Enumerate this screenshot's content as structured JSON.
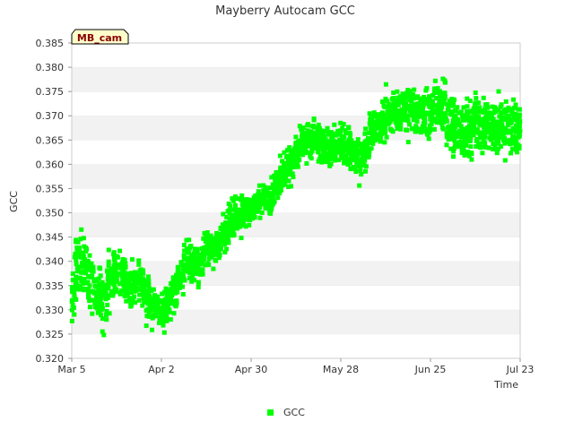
{
  "chart_data": {
    "type": "scatter",
    "title": "Mayberry Autocam GCC",
    "xlabel": "Time",
    "ylabel": "GCC",
    "badge": "MB_cam",
    "x_ticks": [
      "Mar 5",
      "Apr 2",
      "Apr 30",
      "May 28",
      "Jun 25",
      "Jul 23"
    ],
    "y_ticks": [
      "0.320",
      "0.325",
      "0.330",
      "0.335",
      "0.340",
      "0.345",
      "0.350",
      "0.355",
      "0.360",
      "0.365",
      "0.370",
      "0.375",
      "0.380",
      "0.385"
    ],
    "xlim": [
      "Mar 5",
      "Jul 23"
    ],
    "ylim": [
      0.32,
      0.385
    ],
    "grid": "horizontal alternating bands",
    "legend_position": "bottom-center",
    "colors": {
      "series": "#00ff00",
      "badge_fill": "#ffffcc",
      "badge_text": "#8b0000",
      "band": "#f2f2f2"
    },
    "series": [
      {
        "name": "GCC",
        "x": [
          "Mar 5",
          "Mar 7",
          "Mar 9",
          "Mar 11",
          "Mar 13",
          "Mar 15",
          "Mar 17",
          "Mar 19",
          "Mar 21",
          "Mar 23",
          "Mar 25",
          "Mar 27",
          "Mar 29",
          "Mar 31",
          "Apr 2",
          "Apr 4",
          "Apr 6",
          "Apr 8",
          "Apr 10",
          "Apr 12",
          "Apr 14",
          "Apr 16",
          "Apr 18",
          "Apr 20",
          "Apr 22",
          "Apr 24",
          "Apr 26",
          "Apr 28",
          "Apr 30",
          "May 2",
          "May 4",
          "May 6",
          "May 8",
          "May 10",
          "May 12",
          "May 14",
          "May 16",
          "May 18",
          "May 20",
          "May 22",
          "May 24",
          "May 26",
          "May 28",
          "May 30",
          "Jun 1",
          "Jun 3",
          "Jun 5",
          "Jun 7",
          "Jun 9",
          "Jun 11",
          "Jun 13",
          "Jun 15",
          "Jun 17",
          "Jun 19",
          "Jun 21",
          "Jun 23",
          "Jun 25",
          "Jun 27",
          "Jun 29",
          "Jul 1",
          "Jul 3",
          "Jul 5",
          "Jul 7",
          "Jul 9",
          "Jul 11",
          "Jul 13",
          "Jul 15",
          "Jul 17",
          "Jul 19",
          "Jul 21",
          "Jul 23"
        ],
        "y": [
          0.334,
          0.339,
          0.34,
          0.336,
          0.333,
          0.332,
          0.336,
          0.338,
          0.337,
          0.335,
          0.336,
          0.335,
          0.332,
          0.331,
          0.33,
          0.331,
          0.334,
          0.337,
          0.34,
          0.339,
          0.34,
          0.342,
          0.343,
          0.344,
          0.346,
          0.348,
          0.349,
          0.35,
          0.351,
          0.352,
          0.353,
          0.353,
          0.356,
          0.358,
          0.36,
          0.362,
          0.364,
          0.365,
          0.365,
          0.364,
          0.363,
          0.364,
          0.364,
          0.364,
          0.362,
          0.361,
          0.363,
          0.367,
          0.369,
          0.37,
          0.371,
          0.371,
          0.372,
          0.372,
          0.371,
          0.37,
          0.371,
          0.372,
          0.371,
          0.369,
          0.367,
          0.367,
          0.368,
          0.369,
          0.368,
          0.368,
          0.367,
          0.368,
          0.368,
          0.368,
          0.368
        ],
        "spread": [
          0.009,
          0.008,
          0.007,
          0.007,
          0.007,
          0.007,
          0.006,
          0.006,
          0.006,
          0.006,
          0.006,
          0.006,
          0.006,
          0.005,
          0.005,
          0.005,
          0.005,
          0.005,
          0.005,
          0.005,
          0.005,
          0.005,
          0.005,
          0.005,
          0.005,
          0.005,
          0.005,
          0.004,
          0.004,
          0.004,
          0.004,
          0.004,
          0.004,
          0.005,
          0.005,
          0.005,
          0.005,
          0.005,
          0.005,
          0.005,
          0.005,
          0.005,
          0.005,
          0.006,
          0.006,
          0.006,
          0.006,
          0.006,
          0.006,
          0.006,
          0.006,
          0.006,
          0.006,
          0.006,
          0.006,
          0.007,
          0.007,
          0.007,
          0.007,
          0.007,
          0.007,
          0.007,
          0.007,
          0.007,
          0.007,
          0.007,
          0.007,
          0.007,
          0.007,
          0.007,
          0.007
        ]
      }
    ]
  }
}
